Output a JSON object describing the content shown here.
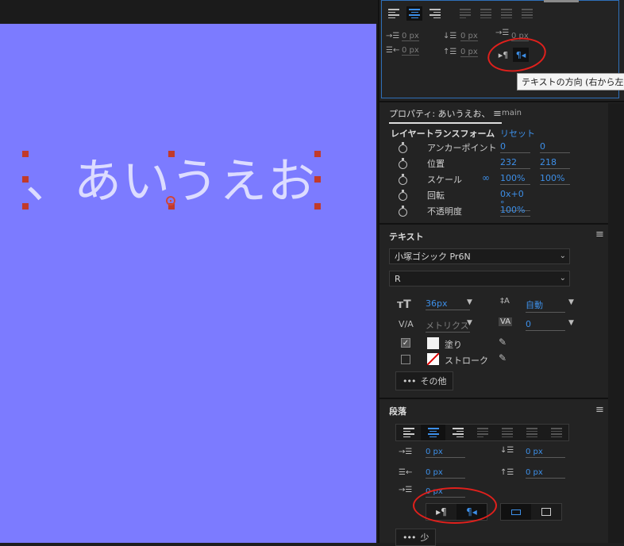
{
  "canvas": {
    "text": "、あいうえお",
    "background_color": "#7c7bff"
  },
  "paragraph_top": {
    "indent_left": "0 px",
    "space_before": "0 px",
    "first_line_indent": "0 px",
    "indent_right": "0 px",
    "space_after": "0 px",
    "ltr_icon": "▸¶",
    "rtl_icon": "¶◂"
  },
  "tooltip": {
    "text": "テキストの方向 (右から左)"
  },
  "properties": {
    "tab_label": "プロパティ: あいうえお、",
    "menu_icon": "≡",
    "tab_main": "main",
    "layer_transform_title": "レイヤートランスフォーム",
    "reset": "リセット",
    "rows": [
      {
        "label": "アンカーポイント",
        "v1": "0",
        "v2": "0"
      },
      {
        "label": "位置",
        "v1": "232",
        "v2": "218"
      },
      {
        "label": "スケール",
        "v1": "100%",
        "v2": "100%"
      },
      {
        "label": "回転",
        "v1": "0x+0 °",
        "v2": ""
      },
      {
        "label": "不透明度",
        "v1": "100%",
        "v2": ""
      }
    ],
    "link_icon": "∞"
  },
  "text_panel": {
    "title": "テキスト",
    "font_family": "小塚ゴシック Pr6N",
    "font_style": "R",
    "font_size": "36",
    "font_size_unit": "px",
    "leading": "自動",
    "kerning": "メトリクス",
    "tracking": "0",
    "fill_label": "塗り",
    "stroke_label": "ストローク",
    "more_label": "その他",
    "dots": "•••",
    "check": "✓",
    "chevron": "⌄",
    "dropdown_arrow": "▼"
  },
  "paragraph_panel": {
    "title": "段落",
    "indent_left": "0 px",
    "space_before": "0 px",
    "indent_right": "0 px",
    "space_after": "0 px",
    "first_line_indent": "0 px",
    "less_label": "少"
  },
  "colors": {
    "accent": "#3d8fe8",
    "annotation": "#e0201c",
    "canvas": "#7c7bff"
  }
}
